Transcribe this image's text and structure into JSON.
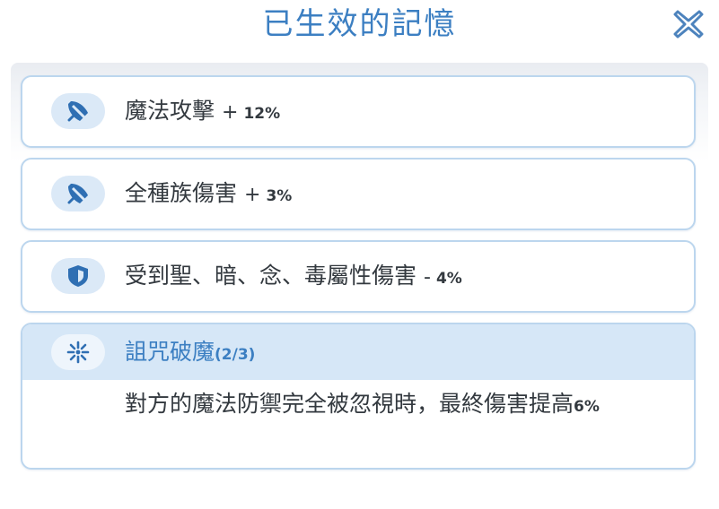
{
  "dialog": {
    "title": "已生效的記憶",
    "close_icon": "close-x-icon"
  },
  "effects": [
    {
      "icon": "magic-wand-icon",
      "name": "魔法攻擊",
      "sign": "+",
      "value": "12%"
    },
    {
      "icon": "magic-wand-icon",
      "name": "全種族傷害",
      "sign": "+",
      "value": "3%"
    },
    {
      "icon": "shield-icon",
      "name": "受到聖、暗、念、毒屬性傷害",
      "sign": "-",
      "value": "4%"
    }
  ],
  "curse_card": {
    "icon": "snowflake-burst-icon",
    "title": "詛咒破魔",
    "count": "(2/3)",
    "description_text": "對方的魔法防禦完全被忽視時，最終傷害提高",
    "description_value": "6%"
  },
  "colors": {
    "accent": "#3c7fc2",
    "card_border": "#bcd6ee",
    "icon_bg": "#dbe9f7",
    "header_bg": "#d6e7f7",
    "text": "#33393f"
  }
}
